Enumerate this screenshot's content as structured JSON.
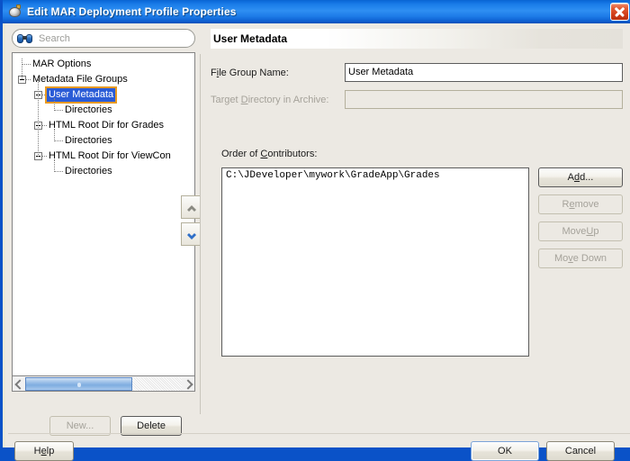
{
  "window": {
    "title": "Edit MAR Deployment Profile Properties",
    "icon": "coffee-cup-icon",
    "close_label": "×",
    "title_bar_color": "#1a7ce8",
    "border_color": "#0a52c8"
  },
  "search": {
    "placeholder": "Search",
    "icon": "binoculars-icon"
  },
  "tree": {
    "items": [
      {
        "label": "MAR Options",
        "depth": 0,
        "expandable": false,
        "selected": false
      },
      {
        "label": "Metadata File Groups",
        "depth": 0,
        "expandable": true,
        "selected": false
      },
      {
        "label": "User Metadata",
        "depth": 1,
        "expandable": true,
        "selected": true
      },
      {
        "label": "Directories",
        "depth": 2,
        "expandable": false,
        "selected": false
      },
      {
        "label": "HTML Root Dir for Grades",
        "depth": 1,
        "expandable": true,
        "selected": false
      },
      {
        "label": "Directories",
        "depth": 2,
        "expandable": false,
        "selected": false
      },
      {
        "label": "HTML Root Dir for ViewCon",
        "depth": 1,
        "expandable": true,
        "selected": false
      },
      {
        "label": "Directories",
        "depth": 2,
        "expandable": false,
        "selected": false
      }
    ],
    "selection_fill": "#2a5cd7",
    "selection_border": "#e89a20"
  },
  "tree_toolbar": {
    "move_up": "▲",
    "move_down": "▼"
  },
  "tree_buttons": {
    "new_label": "New...",
    "new_enabled": false,
    "delete_label": "Delete",
    "delete_enabled": true
  },
  "detail": {
    "header": "User Metadata",
    "file_group_name": {
      "label_pre": "F",
      "label_mnemonic": "i",
      "label_post": "le Group Name:",
      "value": "User Metadata",
      "enabled": true
    },
    "target_directory": {
      "label_pre": "Target ",
      "label_mnemonic": "D",
      "label_post": "irectory in Archive:",
      "value": "",
      "enabled": false
    },
    "order_of_contributors": {
      "label_pre": "Order of ",
      "label_mnemonic": "C",
      "label_post": "ontributors:",
      "items": [
        "C:\\JDeveloper\\mywork\\GradeApp\\Grades"
      ]
    },
    "side_buttons": [
      {
        "pre": "A",
        "mnemonic": "d",
        "post": "d...",
        "enabled": true
      },
      {
        "pre": "R",
        "mnemonic": "e",
        "post": "move",
        "enabled": false
      },
      {
        "pre": "Move ",
        "mnemonic": "U",
        "post": "p",
        "enabled": false
      },
      {
        "pre": "Mo",
        "mnemonic": "v",
        "post": "e Down",
        "enabled": false
      }
    ]
  },
  "footer": {
    "help_pre": "H",
    "help_mnemonic": "e",
    "help_post": "lp",
    "ok_label": "OK",
    "cancel_label": "Cancel"
  }
}
